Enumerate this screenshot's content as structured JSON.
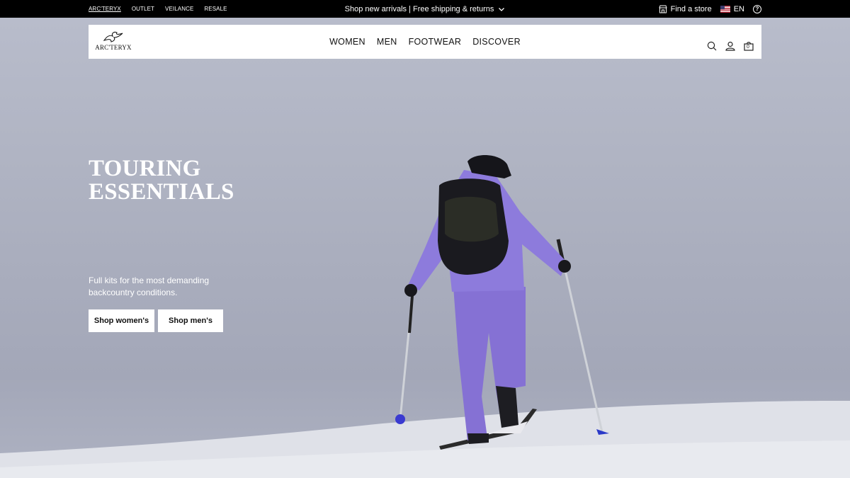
{
  "topbar": {
    "brand_links": [
      "ARC'TERYX",
      "OUTLET",
      "VEILANCE",
      "RESALE"
    ],
    "promo_text": "Shop new arrivals | Free shipping & returns",
    "find_store": "Find a store",
    "language": "EN",
    "help_symbol": "?"
  },
  "header": {
    "logo_text": "ARC'TERYX",
    "nav": [
      "WOMEN",
      "MEN",
      "FOOTWEAR",
      "DISCOVER"
    ],
    "icons": [
      "search-icon",
      "account-icon",
      "cart-icon"
    ],
    "cart_count": "0"
  },
  "hero": {
    "title_line1": "TOURING",
    "title_line2": "ESSENTIALS",
    "subtitle": "Full kits for the most demanding backcountry conditions.",
    "cta_women": "Shop women's",
    "cta_men": "Shop men's"
  },
  "colors": {
    "topbar_bg": "#000000",
    "sky": "#b3b7c6",
    "snow": "#e6e8ee",
    "jacket_purple": "#8a78d6"
  }
}
